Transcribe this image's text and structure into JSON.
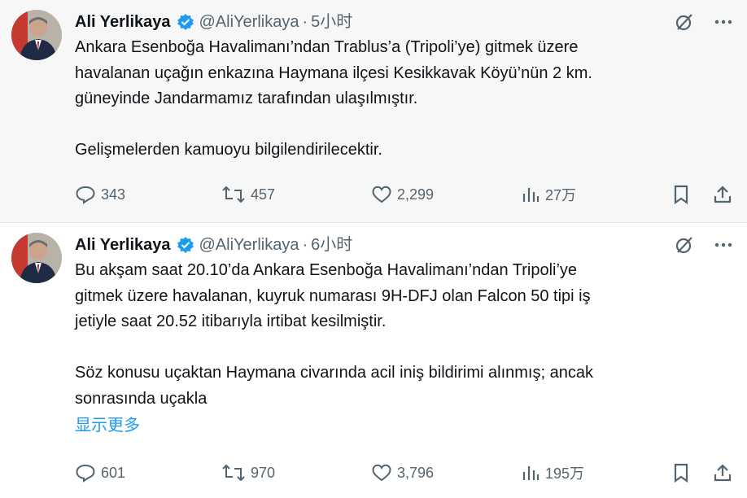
{
  "tweets": [
    {
      "name": "Ali Yerlikaya",
      "handle": "@AliYerlikaya",
      "separator": "·",
      "time": "5小时",
      "text": "Ankara Esenboğa Havalimanı’ndan Trablus’a (Tripoli’ye) gitmek üzere\nhavalanan uçağın enkazına Haymana ilçesi Kesikkavak Köyü’nün 2 km.\ngüneyinde Jandarmamız tarafından ulaşılmıştır.\n\nGelişmelerden kamuoyu bilgilendirilecektir.",
      "show_more": "",
      "replies": "343",
      "retweets": "457",
      "likes": "2,299",
      "views": "27万"
    },
    {
      "name": "Ali Yerlikaya",
      "handle": "@AliYerlikaya",
      "separator": "·",
      "time": "6小时",
      "text": "Bu akşam saat 20.10’da Ankara Esenboğa Havalimanı’ndan Tripoli’ye\ngitmek üzere havalanan, kuyruk numarası 9H-DFJ olan Falcon 50 tipi iş\njetiyle saat 20.52 itibarıyla irtibat kesilmiştir.\n\nSöz konusu uçaktan Haymana civarında acil iniş bildirimi alınmış; ancak\nsonrasında uçakla",
      "show_more": "显示更多",
      "replies": "601",
      "retweets": "970",
      "likes": "3,796",
      "views": "195万"
    }
  ],
  "icons": {
    "verified": "verified-badge-icon",
    "grok": "grok-icon",
    "more": "more-icon",
    "reply": "reply-icon",
    "retweet": "retweet-icon",
    "like": "heart-icon",
    "views": "views-icon",
    "bookmark": "bookmark-icon",
    "share": "share-icon"
  },
  "colors": {
    "text": "#0f1419",
    "secondary": "#536471",
    "link": "#1d9bf0",
    "verified": "#1d9bf0"
  }
}
